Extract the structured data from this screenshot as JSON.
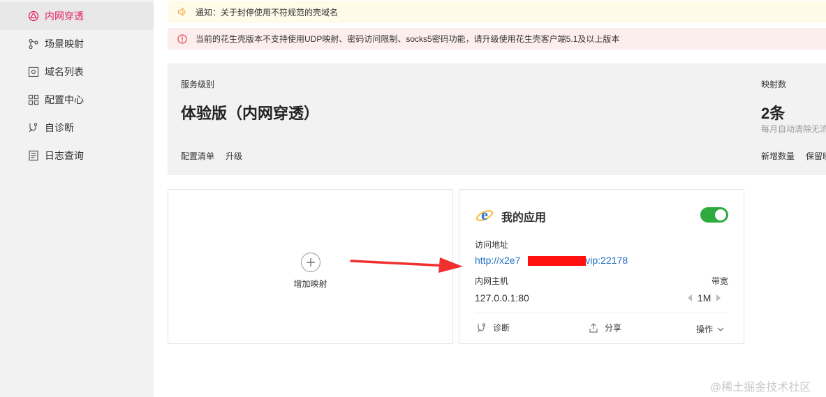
{
  "sidebar": {
    "items": [
      {
        "label": "内网穿透",
        "icon": "tunnel-icon",
        "active": true
      },
      {
        "label": "场景映射",
        "icon": "scene-map-icon",
        "active": false
      },
      {
        "label": "域名列表",
        "icon": "domain-list-icon",
        "active": false
      },
      {
        "label": "配置中心",
        "icon": "config-grid-icon",
        "active": false
      },
      {
        "label": "自诊断",
        "icon": "diagnose-icon",
        "active": false
      },
      {
        "label": "日志查询",
        "icon": "log-icon",
        "active": false
      }
    ]
  },
  "notice": {
    "text": "通知：关于封停使用不符规范的壳域名",
    "icon": "speaker-icon",
    "color": "#e8a93a"
  },
  "warning": {
    "text": "当前的花生壳版本不支持使用UDP映射、密码访问限制、socks5密码功能，请升级使用花生壳客户端5.1及以上版本",
    "icon": "alert-circle-icon",
    "color": "#e0424a"
  },
  "service": {
    "level_label": "服务级别",
    "level_value": "体验版（内网穿透）",
    "links": [
      "配置清单",
      "升级"
    ],
    "mapping_label": "映射数",
    "mapping_value": "2条",
    "mapping_note": "每月自动清除无流",
    "mapping_links": [
      "新增数量",
      "保留映"
    ]
  },
  "add_card": {
    "label": "增加映射"
  },
  "app_card": {
    "title": "我的应用",
    "enabled": true,
    "address_label": "访问地址",
    "address_prefix": "http://x2e7",
    "address_suffix": "vip:22178",
    "host_label": "内网主机",
    "host_value": "127.0.0.1:80",
    "bandwidth_label": "带宽",
    "bandwidth_value": "1M",
    "actions": {
      "diagnose": "诊断",
      "share": "分享",
      "operate": "操作"
    }
  },
  "colors": {
    "accent": "#e3235f",
    "toggle_on": "#2eaa3f",
    "link": "#1f6fc1",
    "arrow": "#f0302f"
  },
  "watermark": "@稀土掘金技术社区"
}
